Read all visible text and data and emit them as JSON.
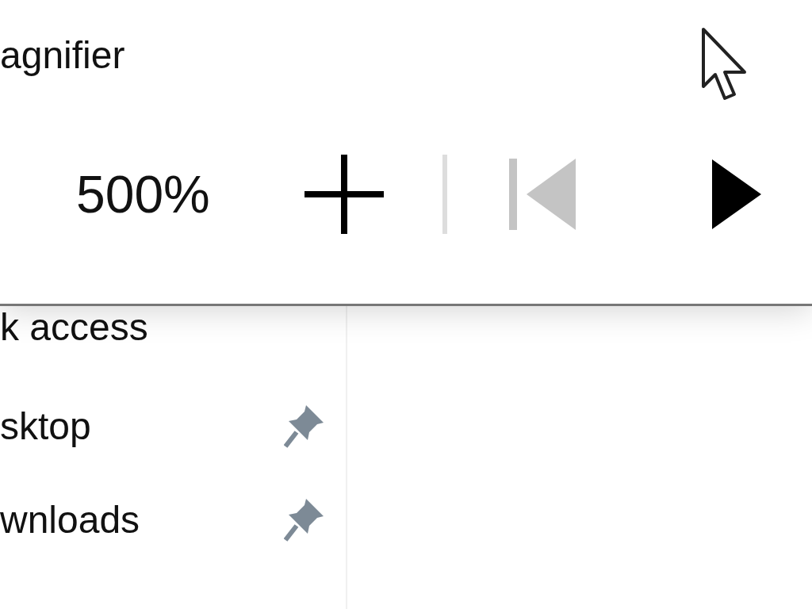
{
  "window": {
    "title": "agnifier"
  },
  "toolbar": {
    "zoom": "500%",
    "buttons": [
      {
        "kind": "zoom-in",
        "disabled": false
      },
      {
        "kind": "previous",
        "disabled": true
      },
      {
        "kind": "play",
        "disabled": false
      }
    ]
  },
  "navigation": {
    "section": "k access",
    "items": [
      {
        "label": "sktop",
        "pinned": true
      },
      {
        "label": "wnloads",
        "pinned": true
      }
    ]
  }
}
